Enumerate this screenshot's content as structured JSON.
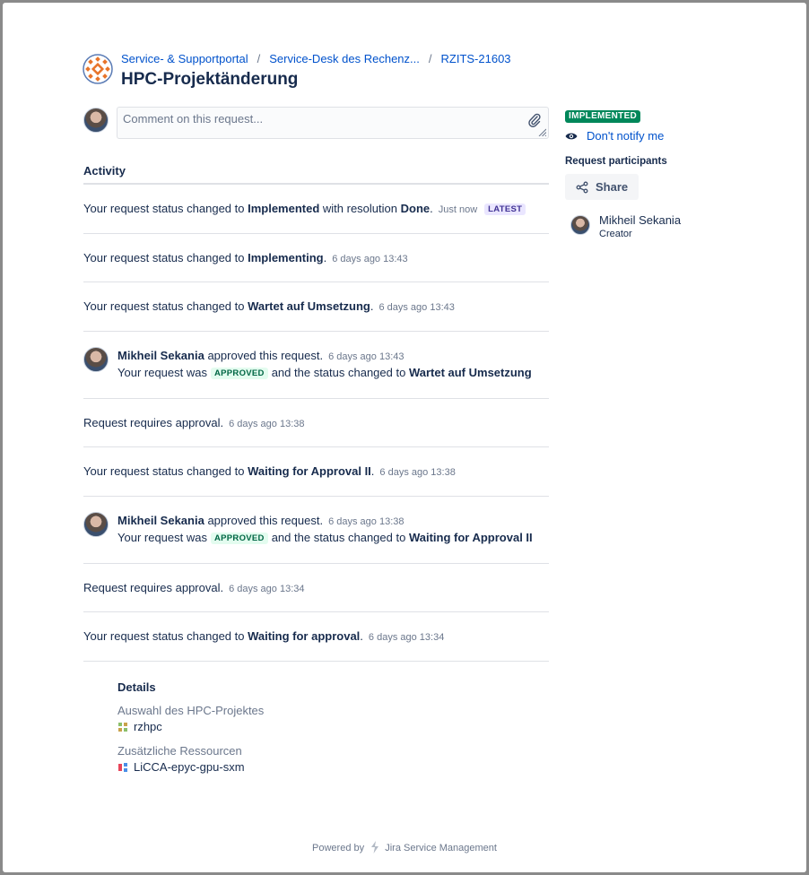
{
  "breadcrumb": [
    {
      "label": "Service- & Supportportal"
    },
    {
      "label": "Service-Desk des Rechenz..."
    },
    {
      "label": "RZITS-21603"
    }
  ],
  "page_title": "HPC-Projektänderung",
  "comment": {
    "placeholder": "Comment on this request..."
  },
  "activity": {
    "heading": "Activity",
    "items": [
      {
        "pre": "Your request status changed to ",
        "strong": "Implemented",
        "mid": " with resolution ",
        "strong2": "Done",
        "post": ".",
        "time": "Just now",
        "badge": "LATEST"
      },
      {
        "pre": "Your request status changed to ",
        "strong": "Implementing",
        "post": ".",
        "time": "6 days ago 13:43"
      },
      {
        "pre": "Your request status changed to ",
        "strong": "Wartet auf Umsetzung",
        "post": ".",
        "time": "6 days ago 13:43"
      },
      {
        "user": "Mikheil Sekania",
        "action": " approved this request.",
        "time": "6 days ago 13:43",
        "l2_pre": "Your request was",
        "badge": "APPROVED",
        "l2_mid": "and the status changed to ",
        "l2_strong": "Wartet auf Umsetzung"
      },
      {
        "text": "Request requires approval.",
        "time": "6 days ago 13:38"
      },
      {
        "pre": "Your request status changed to ",
        "strong": "Waiting for Approval II",
        "post": ".",
        "time": "6 days ago 13:38"
      },
      {
        "user": "Mikheil Sekania",
        "action": " approved this request.",
        "time": "6 days ago 13:38",
        "l2_pre": "Your request was",
        "badge": "APPROVED",
        "l2_mid": "and the status changed to ",
        "l2_strong": "Waiting for Approval II"
      },
      {
        "text": "Request requires approval.",
        "time": "6 days ago 13:34"
      },
      {
        "pre": "Your request status changed to ",
        "strong": "Waiting for approval",
        "post": ".",
        "time": "6 days ago 13:34"
      }
    ]
  },
  "details": {
    "title": "Details",
    "fields": [
      {
        "label": "Auswahl des HPC-Projektes",
        "value": "rzhpc",
        "icon": "project-icon"
      },
      {
        "label": "Zusätzliche Ressourcen",
        "value": "LiCCA-epyc-gpu-sxm",
        "icon": "resource-icon"
      }
    ]
  },
  "sidebar": {
    "status": "IMPLEMENTED",
    "notify": "Don't notify me",
    "participants_heading": "Request participants",
    "share": "Share",
    "participant": {
      "name": "Mikheil Sekania",
      "role": "Creator"
    }
  },
  "footer": {
    "prefix": "Powered by",
    "product": "Jira Service Management"
  },
  "colors": {
    "link": "#0052cc",
    "status_implemented": "#00875a",
    "text": "#172b4d",
    "muted": "#6b778c"
  }
}
